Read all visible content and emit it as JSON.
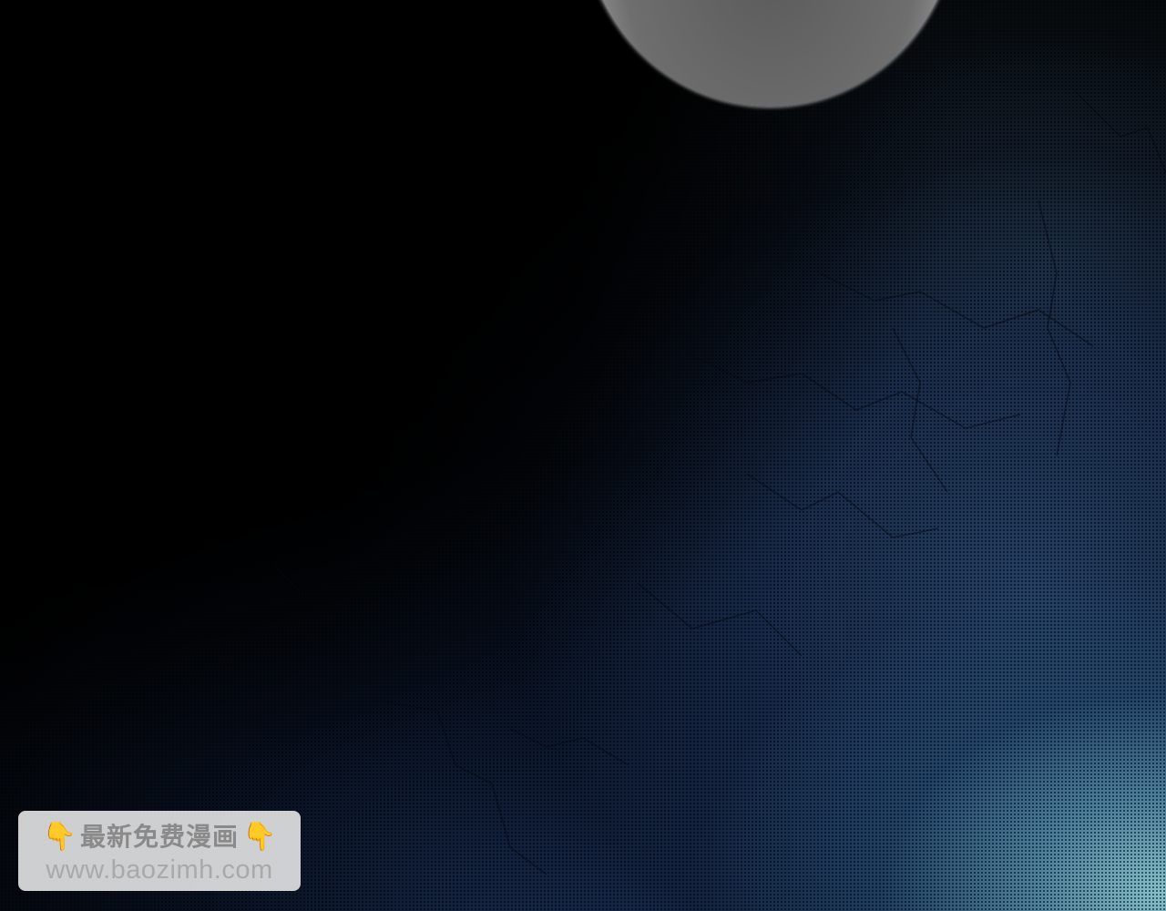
{
  "scene": {
    "description_icon": "glowing-orb",
    "colors": {
      "background": "#000000",
      "deep_blue": "#1c3258",
      "cyan_glow": "#8ccdd7",
      "orb_rim": "#ffffff",
      "orb_core": "#5a5a5a"
    }
  },
  "watermark": {
    "title": "最新免费漫画",
    "url": "www.baozimh.com",
    "left_icon": "pointing-down-hand-icon",
    "right_icon": "pointing-down-hand-icon",
    "hand_glyph": "👇"
  }
}
